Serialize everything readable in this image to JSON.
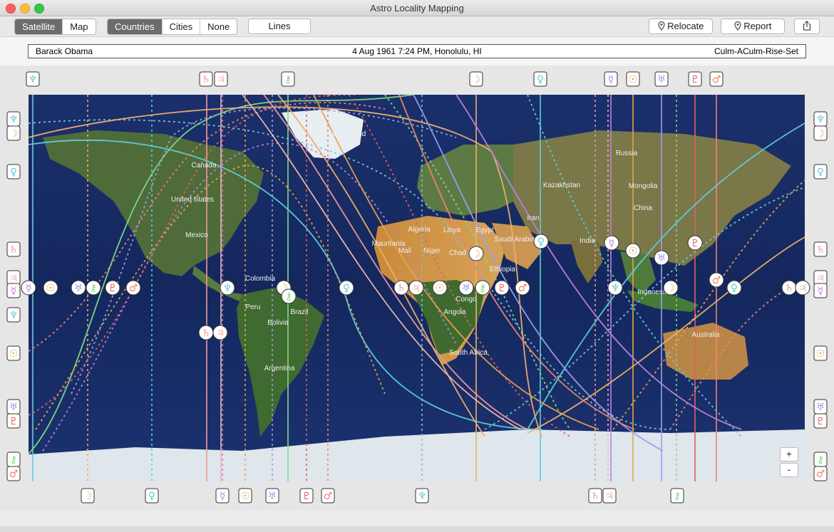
{
  "window": {
    "title": "Astro Locality Mapping"
  },
  "toolbar": {
    "view_modes": [
      "Satellite",
      "Map"
    ],
    "labels_modes": [
      "Countries",
      "Cities",
      "None"
    ],
    "lines_label": "Lines",
    "relocate_label": "Relocate",
    "report_label": "Report"
  },
  "info": {
    "name": "Barack Obama",
    "birth": "4 Aug 1961 7:24 PM, Honolulu, HI",
    "mode": "Culm-ACulm-Rise-Set"
  },
  "map": {
    "country_labels": [
      "Greenland",
      "Canada",
      "United States",
      "Mexico",
      "Colombia",
      "Peru",
      "Bolivia",
      "Brazil",
      "Argentina",
      "Algeria",
      "Mauritania",
      "Mali",
      "Niger",
      "Libya",
      "Egypt",
      "Chad",
      "Saudi Arabia",
      "Ethiopia",
      "Congo",
      "Angola",
      "South Africa",
      "Iran",
      "Kazakhstan",
      "Russia",
      "Mongolia",
      "China",
      "India",
      "Indonesia",
      "Australia"
    ],
    "zoom_in": "+",
    "zoom_out": "-"
  },
  "planets": [
    {
      "name": "Sun",
      "glyph": "☉",
      "color": "#e8a24a"
    },
    {
      "name": "Moon",
      "glyph": "☽",
      "color": "#f0b06a"
    },
    {
      "name": "Mercury",
      "glyph": "☿",
      "color": "#c080e0"
    },
    {
      "name": "Venus",
      "glyph": "♀",
      "color": "#5cd0d8"
    },
    {
      "name": "Mars",
      "glyph": "♂",
      "color": "#ef8470"
    },
    {
      "name": "Jupiter",
      "glyph": "♃",
      "color": "#f2b8a8"
    },
    {
      "name": "Saturn",
      "glyph": "♄",
      "color": "#f09a9a"
    },
    {
      "name": "Uranus",
      "glyph": "♅",
      "color": "#9aa0f0"
    },
    {
      "name": "Neptune",
      "glyph": "♆",
      "color": "#70c8d8"
    },
    {
      "name": "Pluto",
      "glyph": "♇",
      "color": "#e06060"
    },
    {
      "name": "Chiron",
      "glyph": "⚷",
      "color": "#80dc80"
    }
  ]
}
